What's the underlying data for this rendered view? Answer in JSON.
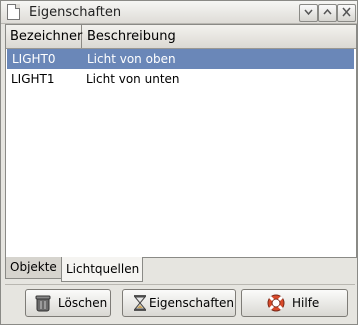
{
  "window": {
    "title": "Eigenschaften"
  },
  "table": {
    "columns": [
      "Bezeichner",
      "Beschreibung"
    ],
    "rows": [
      {
        "id": "LIGHT0",
        "desc": "Licht von oben",
        "selected": true
      },
      {
        "id": "LIGHT1",
        "desc": "Licht von unten",
        "selected": false
      }
    ]
  },
  "tabs": [
    {
      "label": "Objekte",
      "active": false
    },
    {
      "label": "Lichtquellen",
      "active": true
    }
  ],
  "buttons": {
    "delete": "Löschen",
    "properties": "Eigenschaften",
    "help": "Hilfe"
  },
  "icons": {
    "delete": "trash-icon",
    "properties": "hourglass-icon",
    "help": "lifebuoy-icon"
  },
  "colors": {
    "selection": "#6a87b8"
  }
}
